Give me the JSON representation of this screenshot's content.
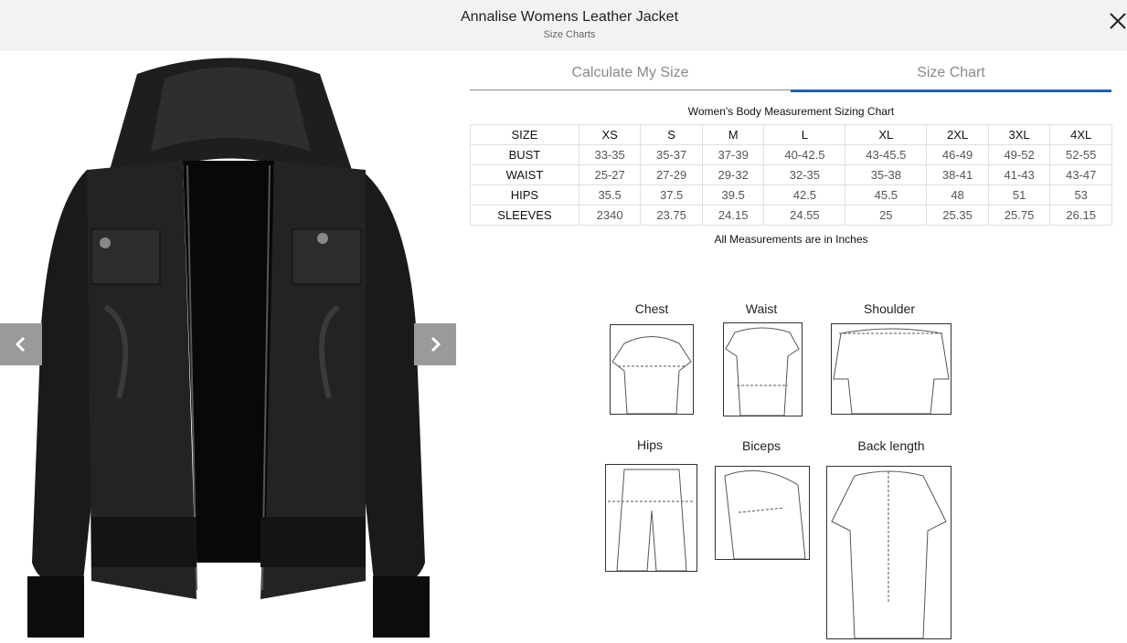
{
  "header": {
    "title": "Annalise Womens Leather Jacket",
    "subtitle": "Size Charts",
    "close_icon": "close-icon"
  },
  "gallery": {
    "prev_icon": "chevron-left-icon",
    "next_icon": "chevron-right-icon",
    "image": "black hooded leather jacket"
  },
  "tabs": {
    "calculate": "Calculate My Size",
    "chart": "Size Chart",
    "active_color": "#1f5fb8"
  },
  "size_chart": {
    "title": "Women's Body Measurement Sizing Chart",
    "columns": [
      "SIZE",
      "XS",
      "S",
      "M",
      "L",
      "XL",
      "2XL",
      "3XL",
      "4XL"
    ],
    "rows": [
      [
        "BUST",
        "33-35",
        "35-37",
        "37-39",
        "40-42.5",
        "43-45.5",
        "46-49",
        "49-52",
        "52-55"
      ],
      [
        "WAIST",
        "25-27",
        "27-29",
        "29-32",
        "32-35",
        "35-38",
        "38-41",
        "41-43",
        "43-47"
      ],
      [
        "HIPS",
        "35.5",
        "37.5",
        "39.5",
        "42.5",
        "45.5",
        "48",
        "51",
        "53"
      ],
      [
        "SLEEVES",
        "2340",
        "23.75",
        "24.15",
        "24.55",
        "25",
        "25.35",
        "25.75",
        "26.15"
      ]
    ],
    "note": "All Measurements are in Inches"
  },
  "diagram": {
    "labels": [
      "Chest",
      "Waist",
      "Shoulder",
      "Hips",
      "Biceps",
      "Back length"
    ]
  }
}
